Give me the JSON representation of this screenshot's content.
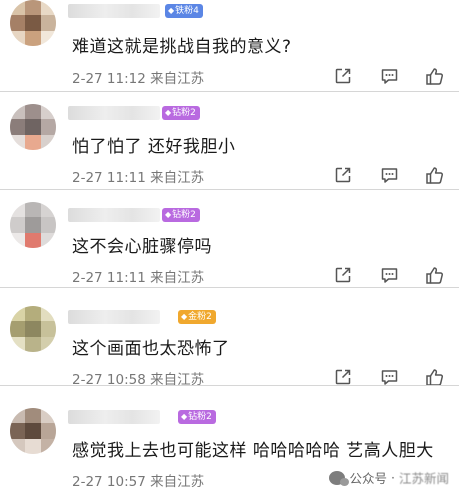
{
  "comments": [
    {
      "badge": {
        "label": "铁粉4",
        "color": "#5b86e5"
      },
      "text": "难道这就是挑战自我的意义?",
      "time": "2-27 11:12",
      "location": "来自江苏",
      "avatar_colors": [
        "#d9c3a8",
        "#b9967a",
        "#e8d9c6",
        "#a58066",
        "#7a5a44",
        "#c9b39c",
        "#e7d6c3",
        "#caa17e",
        "#f1e7da"
      ]
    },
    {
      "badge": {
        "label": "钻粉2",
        "color": "#b96ae0"
      },
      "text": "怕了怕了 还好我胆小",
      "time": "2-27 11:11",
      "location": "来自江苏",
      "avatar_colors": [
        "#c9c0bd",
        "#9d8f8c",
        "#d7cfcc",
        "#8b7d7a",
        "#6f6462",
        "#b5a8a4",
        "#e5dedb",
        "#e8a98f",
        "#d8d0cc"
      ]
    },
    {
      "badge": {
        "label": "钻粉2",
        "color": "#b96ae0"
      },
      "text": "这不会心脏骤停吗",
      "time": "2-27 11:11",
      "location": "来自江苏",
      "avatar_colors": [
        "#e4e1e0",
        "#b9b6b5",
        "#d6d3d2",
        "#cfcccb",
        "#9e9b9a",
        "#c8c5c4",
        "#ece9e8",
        "#e07a6e",
        "#dedbda"
      ]
    },
    {
      "badge": {
        "label": "金粉2",
        "color": "#f0a82e"
      },
      "text": "这个画面也太恐怖了",
      "time": "2-27 10:58",
      "location": "来自江苏",
      "avatar_colors": [
        "#d9d3a6",
        "#b4ad7c",
        "#e2ddbf",
        "#a59e70",
        "#8d8760",
        "#c7c19a",
        "#e4e0c4",
        "#b9b38a",
        "#d3ceac"
      ]
    },
    {
      "badge": {
        "label": "钻粉2",
        "color": "#b96ae0"
      },
      "text": "感觉我上去也可能这样 哈哈哈哈哈 艺高人胆大",
      "time": "2-27 10:57",
      "location": "来自江苏",
      "avatar_colors": [
        "#c8bab0",
        "#a18c7c",
        "#d9cdc4",
        "#7a6455",
        "#5e4a3d",
        "#b8a597",
        "#d5c8be",
        "#e7dcd3",
        "#c4b2a5"
      ]
    }
  ],
  "icons": {
    "share": "share-icon",
    "comment": "comment-icon",
    "like": "like-icon"
  },
  "watermark": {
    "label": "公众号",
    "dot": "·",
    "source": "江苏新闻"
  }
}
